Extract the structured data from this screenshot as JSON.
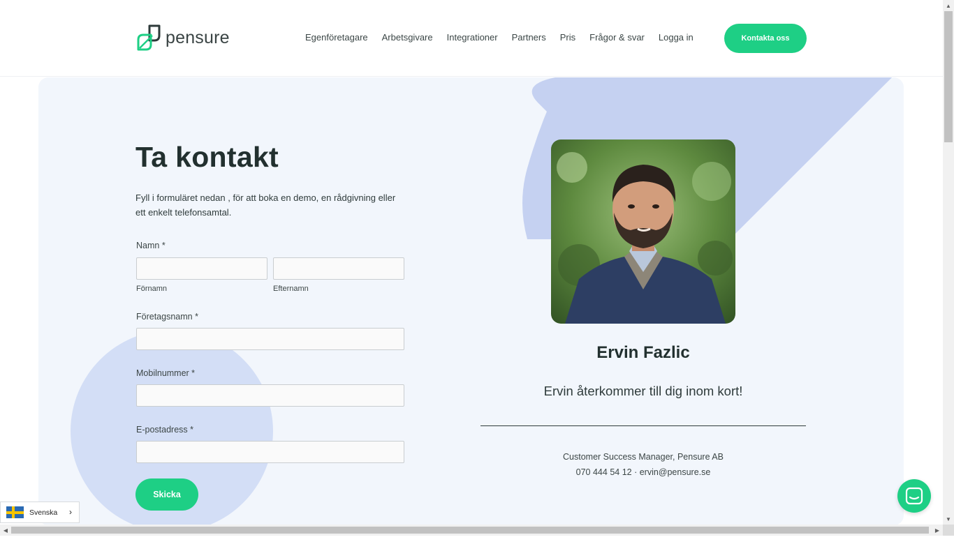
{
  "brand": {
    "name": "pensure",
    "accent": "#1ecf85"
  },
  "nav": {
    "items": [
      "Egenföretagare",
      "Arbetsgivare",
      "Integrationer",
      "Partners",
      "Pris",
      "Frågor & svar",
      "Logga in"
    ],
    "cta_label": "Kontakta oss"
  },
  "form": {
    "title": "Ta kontakt",
    "intro": "Fyll i formuläret nedan , för att boka en demo, en rådgivning eller ett enkelt telefonsamtal.",
    "name_label": "Namn *",
    "first_name_sublabel": "Förnamn",
    "last_name_sublabel": "Efternamn",
    "company_label": "Företagsnamn *",
    "mobile_label": "Mobilnummer *",
    "email_label": "E-postadress *",
    "submit_label": "Skicka",
    "values": {
      "first_name": "",
      "last_name": "",
      "company": "",
      "mobile": "",
      "email": ""
    }
  },
  "contact_person": {
    "name": "Ervin Fazlic",
    "message": "Ervin återkommer till dig inom kort!",
    "role": "Customer Success Manager, Pensure AB",
    "contact": "070 444 54 12 · ervin@pensure.se"
  },
  "language": {
    "selected": "Svenska",
    "icon": "sweden-flag-icon"
  },
  "chat": {
    "icon": "chat-icon"
  }
}
